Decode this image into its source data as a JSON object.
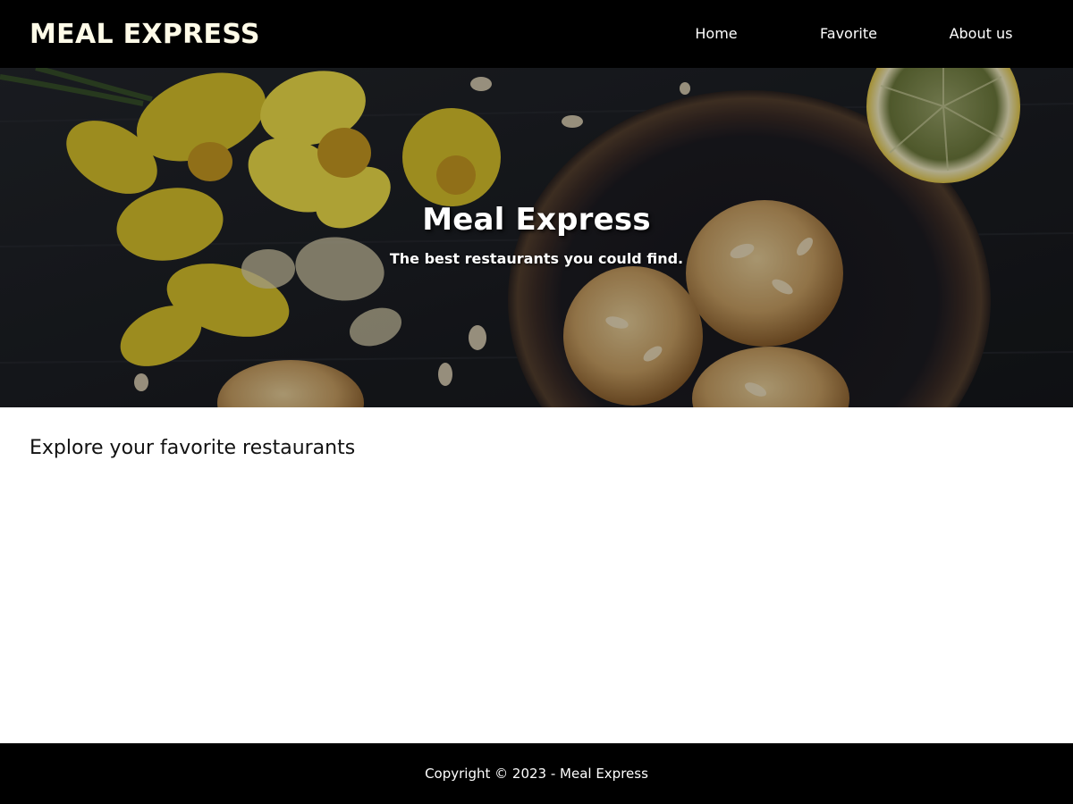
{
  "header": {
    "brand": "MEAL EXPRESS",
    "nav": [
      {
        "label": "Home"
      },
      {
        "label": "Favorite"
      },
      {
        "label": "About us"
      }
    ]
  },
  "hero": {
    "title": "Meal Express",
    "subtitle": "The best restaurants you could find.",
    "image_icon": "food-photo"
  },
  "main": {
    "section_title": "Explore your favorite restaurants"
  },
  "footer": {
    "copyright": "Copyright © 2023 - Meal Express"
  },
  "colors": {
    "header_bg": "#000000",
    "footer_bg": "#000000",
    "page_bg": "#ffffff"
  }
}
